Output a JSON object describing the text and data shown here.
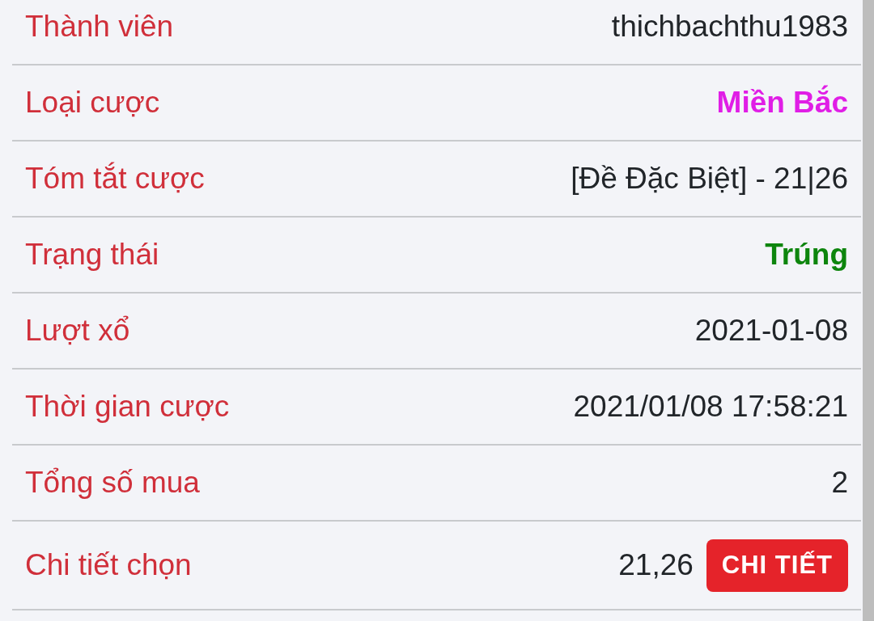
{
  "rows": [
    {
      "kind": "plain",
      "label": "Thành viên",
      "value": "thichbachthu1983"
    },
    {
      "kind": "emphasis",
      "label": "Loại cược",
      "value": "Miền Bắc",
      "color": "#e01ee6"
    },
    {
      "kind": "plain",
      "label": "Tóm tắt cược",
      "value": "[Đề Đặc Biệt] - 21|26"
    },
    {
      "kind": "emphasis",
      "label": "Trạng thái",
      "value": "Trúng",
      "color": "#0d850d"
    },
    {
      "kind": "plain",
      "label": "Lượt xổ",
      "value": "2021-01-08"
    },
    {
      "kind": "plain",
      "label": "Thời gian cược",
      "value": "2021/01/08 17:58:21"
    },
    {
      "kind": "plain",
      "label": "Tổng số mua",
      "value": "2"
    },
    {
      "kind": "action",
      "label": "Chi tiết chọn",
      "value": "21,26",
      "button": "CHI TIẾT"
    }
  ]
}
